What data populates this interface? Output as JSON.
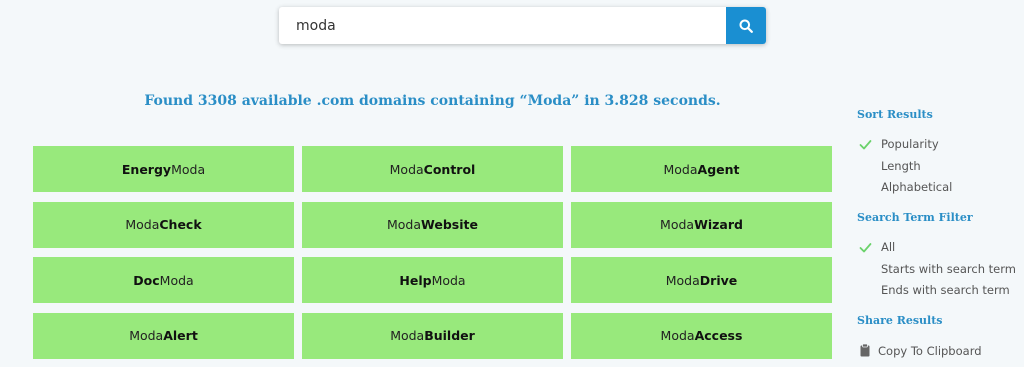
{
  "search": {
    "value": "moda",
    "button_icon": "search-icon"
  },
  "summary": "Found 3308 available .com domains containing “Moda” in 3.828 seconds.",
  "results": [
    {
      "bold": "Energy",
      "plain": "Moda",
      "bold_first": true
    },
    {
      "plain": "Moda",
      "bold": "Control",
      "bold_first": false
    },
    {
      "plain": "Moda",
      "bold": "Agent",
      "bold_first": false
    },
    {
      "plain": "Moda",
      "bold": "Check",
      "bold_first": false
    },
    {
      "plain": "Moda",
      "bold": "Website",
      "bold_first": false
    },
    {
      "plain": "Moda",
      "bold": "Wizard",
      "bold_first": false
    },
    {
      "bold": "Doc",
      "plain": "Moda",
      "bold_first": true
    },
    {
      "bold": "Help",
      "plain": "Moda",
      "bold_first": true
    },
    {
      "plain": "Moda",
      "bold": "Drive",
      "bold_first": false
    },
    {
      "plain": "Moda",
      "bold": "Alert",
      "bold_first": false
    },
    {
      "plain": "Moda",
      "bold": "Builder",
      "bold_first": false
    },
    {
      "plain": "Moda",
      "bold": "Access",
      "bold_first": false
    }
  ],
  "sidebar": {
    "sort": {
      "heading": "Sort Results",
      "options": [
        "Popularity",
        "Length",
        "Alphabetical"
      ],
      "selected": "Popularity"
    },
    "filter": {
      "heading": "Search Term Filter",
      "options": [
        "All",
        "Starts with search term",
        "Ends with search term"
      ],
      "selected": "All"
    },
    "share": {
      "heading": "Share Results",
      "copy_label": "Copy To Clipboard",
      "copy_icon": "clipboard-icon"
    }
  },
  "colors": {
    "accent": "#2a8ec6",
    "button": "#1a8fd2",
    "result_bg": "#98e97c",
    "check": "#6bd26b",
    "page_bg": "#f4f8fa"
  }
}
